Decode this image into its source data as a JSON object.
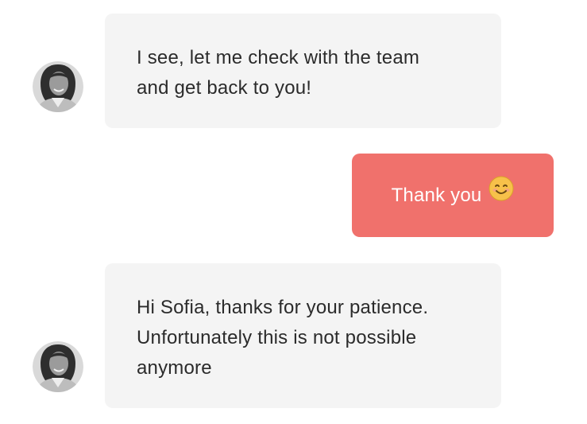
{
  "messages": [
    {
      "id": "m1",
      "direction": "incoming",
      "lines": [
        "I see, let me check with the team",
        "and get back to you!"
      ],
      "avatar_icon": "agent-avatar"
    },
    {
      "id": "m2",
      "direction": "outgoing",
      "text": "Thank you",
      "emoji_icon": "smiling-face-emoji-icon"
    },
    {
      "id": "m3",
      "direction": "incoming",
      "lines": [
        "Hi Sofia, thanks for your patience.",
        "Unfortunately this is not possible",
        "anymore"
      ],
      "avatar_icon": "agent-avatar"
    }
  ],
  "colors": {
    "incoming_bubble": "#f4f4f4",
    "incoming_text": "#2b2b2b",
    "outgoing_bubble": "#f0716c",
    "outgoing_text": "#ffffff",
    "emoji_face": "#f7c14a"
  }
}
